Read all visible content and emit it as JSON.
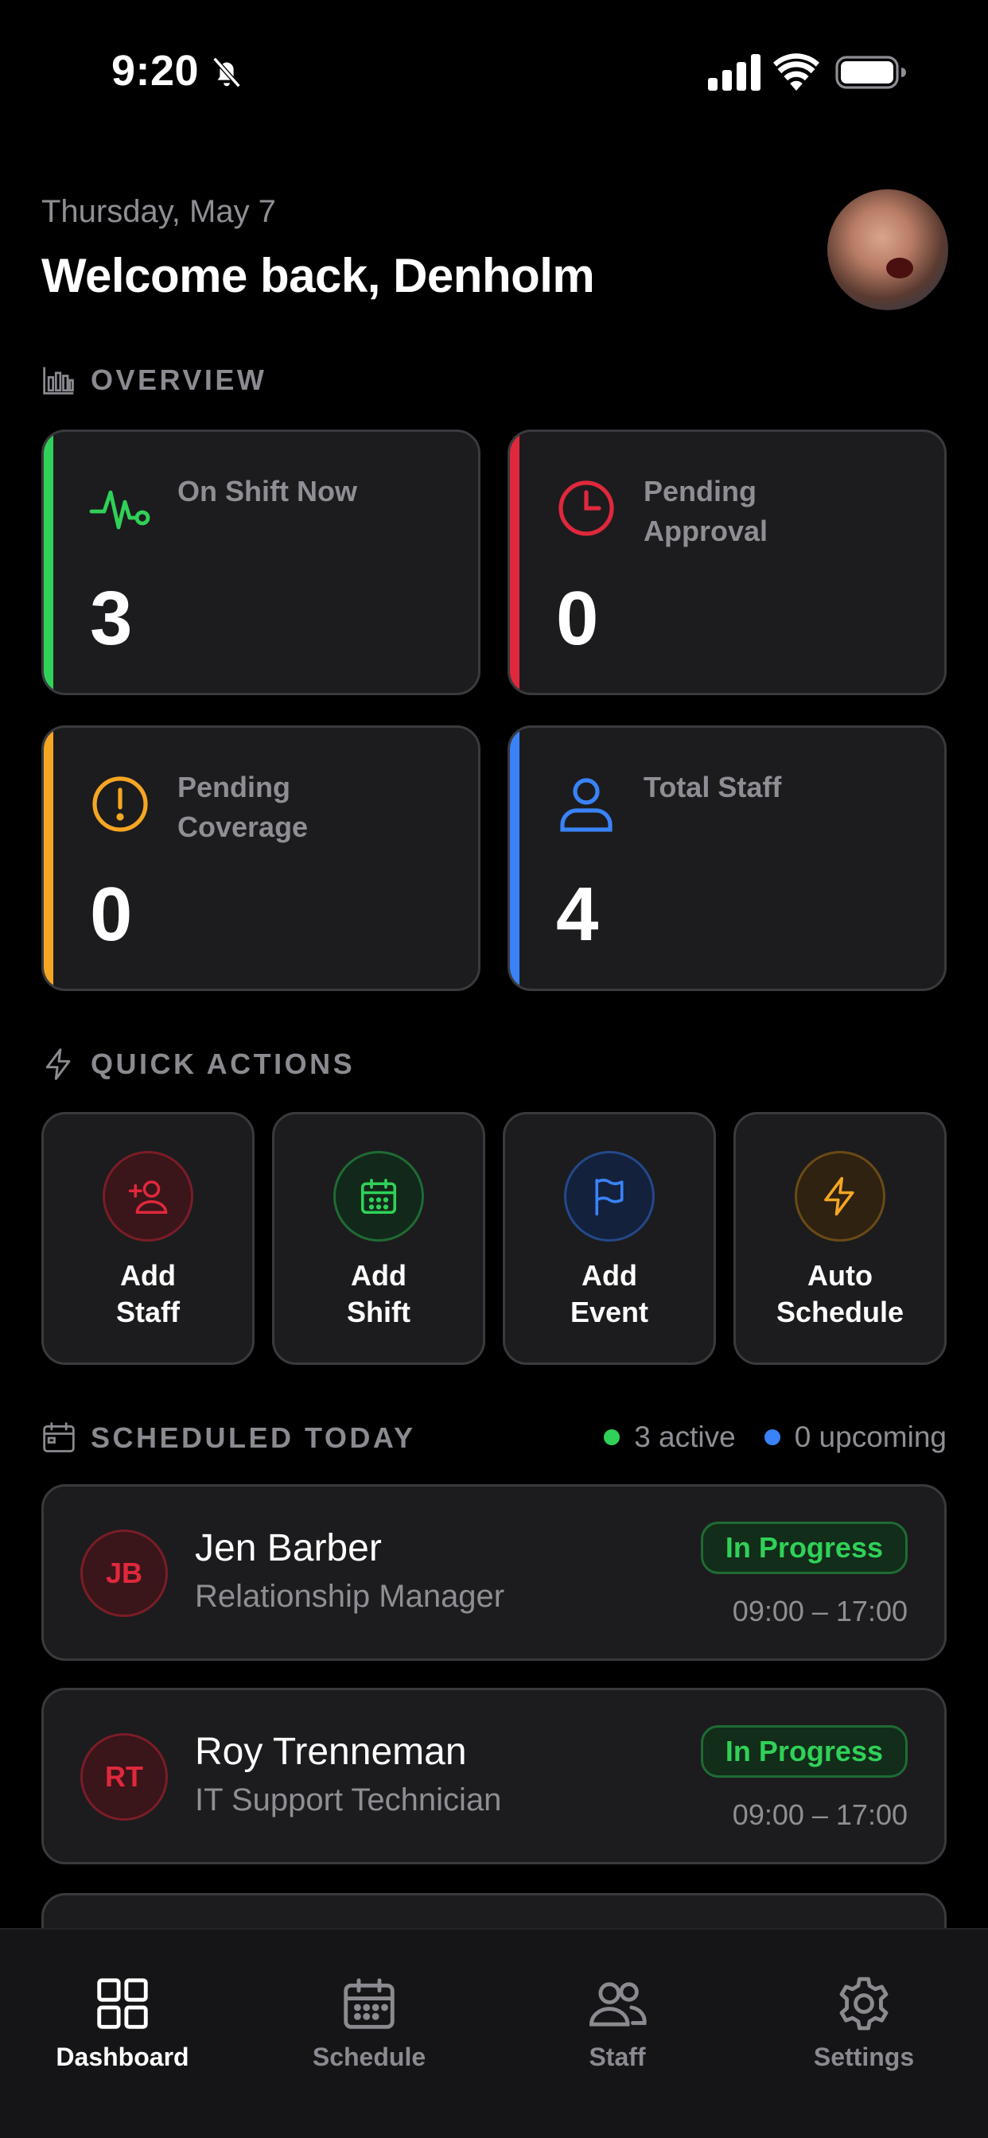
{
  "status_bar": {
    "time": "9:20"
  },
  "header": {
    "date": "Thursday, May 7",
    "welcome": "Welcome back, Denholm"
  },
  "overview": {
    "title": "OVERVIEW",
    "cards": [
      {
        "label": "On Shift Now",
        "value": "3",
        "accent": "#30d158",
        "icon": "heartbeat-icon"
      },
      {
        "label": "Pending Approval",
        "value": "0",
        "accent": "#e0283c",
        "icon": "clock-icon"
      },
      {
        "label": "Pending Coverage",
        "value": "0",
        "accent": "#f5a623",
        "icon": "alert-circle-icon"
      },
      {
        "label": "Total Staff",
        "value": "4",
        "accent": "#3a82f7",
        "icon": "person-icon"
      }
    ]
  },
  "quick_actions": {
    "title": "QUICK ACTIONS",
    "items": [
      {
        "label": "Add\nStaff",
        "color": "#e0283c",
        "icon": "add-user-icon"
      },
      {
        "label": "Add\nShift",
        "color": "#30d158",
        "icon": "calendar-icon"
      },
      {
        "label": "Add\nEvent",
        "color": "#3a82f7",
        "icon": "flag-icon"
      },
      {
        "label": "Auto\nSchedule",
        "color": "#f5a623",
        "icon": "lightning-icon"
      }
    ]
  },
  "scheduled": {
    "title": "SCHEDULED TODAY",
    "active": "3 active",
    "upcoming": "0 upcoming",
    "rows": [
      {
        "initials": "JB",
        "name": "Jen Barber",
        "role": "Relationship Manager",
        "status": "In Progress",
        "time": "09:00 – 17:00"
      },
      {
        "initials": "RT",
        "name": "Roy Trenneman",
        "role": "IT Support Technician",
        "status": "In Progress",
        "time": "09:00 – 17:00"
      }
    ]
  },
  "tabbar": {
    "tabs": [
      {
        "label": "Dashboard",
        "active": true
      },
      {
        "label": "Schedule",
        "active": false
      },
      {
        "label": "Staff",
        "active": false
      },
      {
        "label": "Settings",
        "active": false
      }
    ]
  }
}
